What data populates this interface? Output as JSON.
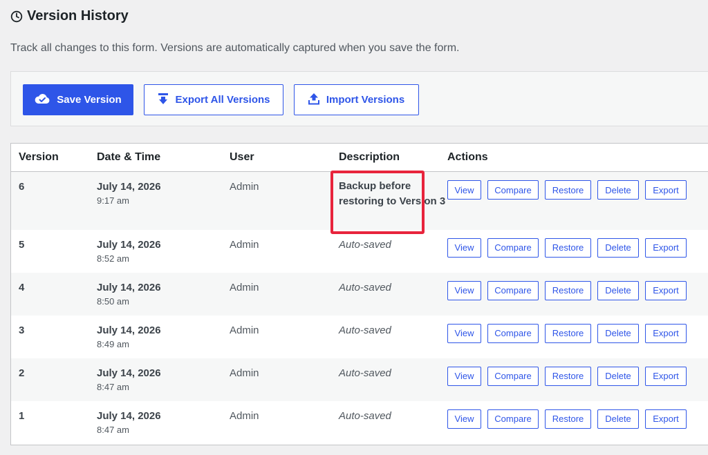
{
  "header": {
    "title": "Version History",
    "icon": "clock-icon",
    "subtitle": "Track all changes to this form. Versions are automatically captured when you save the form."
  },
  "toolbar": {
    "save_label": "Save Version",
    "save_icon": "cloud-check-icon",
    "export_all_label": "Export All Versions",
    "export_all_icon": "download-icon",
    "import_label": "Import Versions",
    "import_icon": "upload-icon"
  },
  "table": {
    "columns": [
      "Version",
      "Date & Time",
      "User",
      "Description",
      "Actions"
    ],
    "action_labels": {
      "view": "View",
      "compare": "Compare",
      "restore": "Restore",
      "delete": "Delete",
      "export": "Export"
    },
    "rows": [
      {
        "version": "6",
        "date": "July 14, 2026",
        "time": "9:17 am",
        "user": "Admin",
        "description": "Backup before restoring to Version 3",
        "highlighted": true
      },
      {
        "version": "5",
        "date": "July 14, 2026",
        "time": "8:52 am",
        "user": "Admin",
        "description": "Auto-saved",
        "highlighted": false
      },
      {
        "version": "4",
        "date": "July 14, 2026",
        "time": "8:50 am",
        "user": "Admin",
        "description": "Auto-saved",
        "highlighted": false
      },
      {
        "version": "3",
        "date": "July 14, 2026",
        "time": "8:49 am",
        "user": "Admin",
        "description": "Auto-saved",
        "highlighted": false
      },
      {
        "version": "2",
        "date": "July 14, 2026",
        "time": "8:47 am",
        "user": "Admin",
        "description": "Auto-saved",
        "highlighted": false
      },
      {
        "version": "1",
        "date": "July 14, 2026",
        "time": "8:47 am",
        "user": "Admin",
        "description": "Auto-saved",
        "highlighted": false
      }
    ]
  },
  "colors": {
    "accent": "#2e55e8",
    "highlight": "#e8243c"
  }
}
